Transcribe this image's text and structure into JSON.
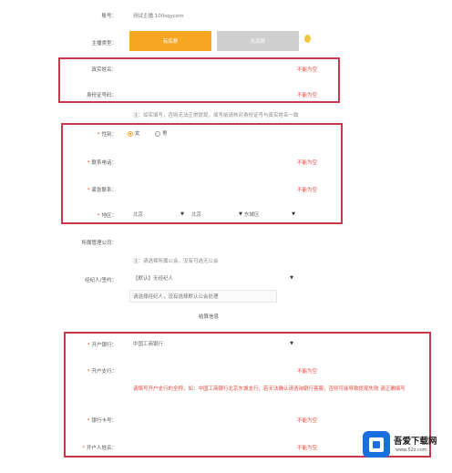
{
  "form": {
    "account_label": "账号：",
    "account_value": "测试主播 100sqycom",
    "type_label": "主播类型：",
    "type_btn_primary": "有底薪",
    "type_btn_secondary": "无底薪",
    "name_label": "真实姓名：",
    "name_error": "不能为空",
    "id_label": "身份证号码：",
    "id_error": "不能为空",
    "id_hint": "注：如实填写，否则无法正常提现，填写前请核对身份证号与真实姓名一致",
    "gender_label": "性别：",
    "gender_options": [
      "女",
      "男"
    ],
    "phone_label": "联系电话：",
    "phone_error": "不能为空",
    "contact_label": "紧急联系：",
    "contact_error": "不能为空",
    "region_label": "地区：",
    "region_province": "北京",
    "region_city": "北京",
    "region_district": "东城区",
    "agency_label": "所属管理公司：",
    "agency_hint": "注：请选择所属公会，没有可选无公会",
    "referrer_label": "经纪人/签约：",
    "referrer_select": "【默认】无经纪人",
    "referrer_note": "请选择经纪人，没有选择默认公会处理",
    "bank_section": "结算信息",
    "bank_label": "开户银行：",
    "bank_value": "中国工商银行",
    "branch_label": "开户支行：",
    "branch_error": "不能为空",
    "branch_warning_1": "请填写开户支行的全称，如：中国工商银行北京东城支行，若无法确认请咨询银行客服，否则可能导致提现失败",
    "branch_warning_2": "请正确填写",
    "card_label": "银行卡号：",
    "card_error": "不能为空",
    "holder_label": "开户人姓名：",
    "holder_error": "不能为空"
  },
  "watermark": {
    "text": "吾爱下载网",
    "url": "www.52z.com"
  },
  "colors": {
    "accent": "#f5a623",
    "disabled": "#cfcfcf",
    "highlight_box": "#c8384a",
    "error": "#e8453c",
    "watermark_blue": "#1a6fe0"
  }
}
